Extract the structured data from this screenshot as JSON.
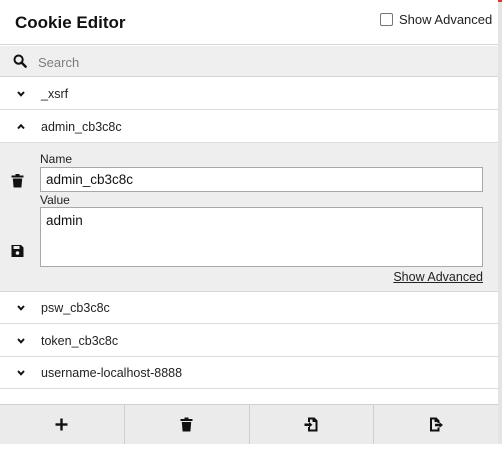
{
  "header": {
    "title": "Cookie Editor",
    "show_advanced_label": "Show Advanced"
  },
  "search": {
    "placeholder": "Search",
    "value": ""
  },
  "cookies": [
    {
      "name": "_xsrf",
      "expanded": false
    },
    {
      "name": "admin_cb3c8c",
      "expanded": true
    },
    {
      "name": "psw_cb3c8c",
      "expanded": false
    },
    {
      "name": "token_cb3c8c",
      "expanded": false
    },
    {
      "name": "username-localhost-8888",
      "expanded": false
    }
  ],
  "editor": {
    "name_label": "Name",
    "name_value": "admin_cb3c8c",
    "value_label": "Value",
    "value_value": "admin",
    "show_advanced_link": "Show Advanced"
  },
  "footer": {
    "buttons": [
      {
        "icon": "plus-icon",
        "action": "add"
      },
      {
        "icon": "trash-icon",
        "action": "delete-all"
      },
      {
        "icon": "import-icon",
        "action": "import"
      },
      {
        "icon": "export-icon",
        "action": "export"
      }
    ]
  },
  "colors": {
    "panel_bg": "#eeeeee",
    "border": "#d6d6d6",
    "text": "#222222"
  }
}
